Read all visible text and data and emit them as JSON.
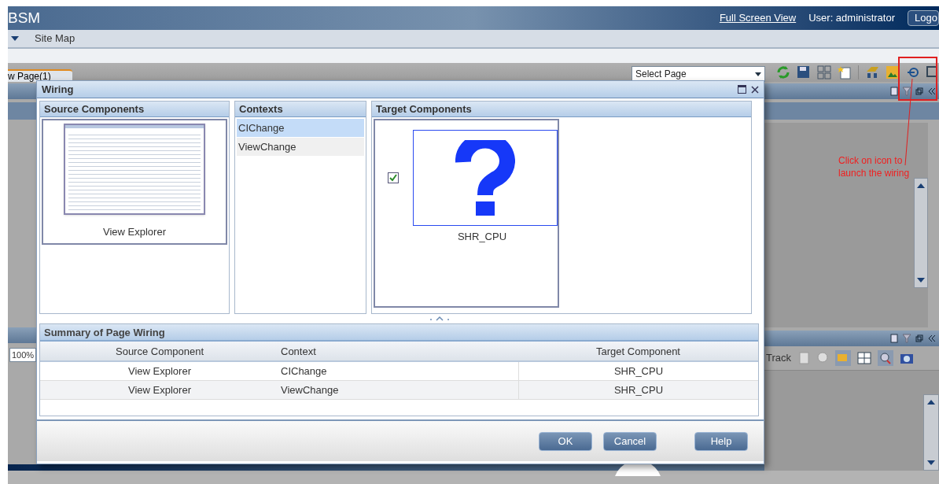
{
  "header": {
    "app_title": "BSM",
    "full_screen_link": "Full Screen View",
    "user": "User: administrator",
    "logout_button": "Logo"
  },
  "menu_bar": {
    "items": [
      "Site Map"
    ]
  },
  "toolbar": {
    "page_tab": "w Page(1)",
    "select_page": {
      "placeholder": "Select Page"
    }
  },
  "lower_toolbar": {
    "zoom": "100%",
    "track_label": "Track"
  },
  "annotation": {
    "text": "Click on icon to launch the wiring"
  },
  "dialog": {
    "title": "Wiring",
    "source_components": {
      "title": "Source Components",
      "items": [
        {
          "label": "View Explorer",
          "selected": true
        }
      ]
    },
    "contexts": {
      "title": "Contexts",
      "items": [
        {
          "label": "CIChange",
          "selected": true
        },
        {
          "label": "ViewChange",
          "selected": false
        }
      ]
    },
    "target_components": {
      "title": "Target Components",
      "items": [
        {
          "label": "SHR_CPU",
          "checked": true
        }
      ]
    },
    "summary": {
      "title": "Summary of Page Wiring",
      "columns": [
        "Source Component",
        "Context",
        "Target Component"
      ],
      "rows": [
        [
          "View Explorer",
          "CIChange",
          "SHR_CPU"
        ],
        [
          "View Explorer",
          "ViewChange",
          "SHR_CPU"
        ]
      ]
    },
    "buttons": [
      "OK",
      "Cancel",
      "Help"
    ]
  }
}
